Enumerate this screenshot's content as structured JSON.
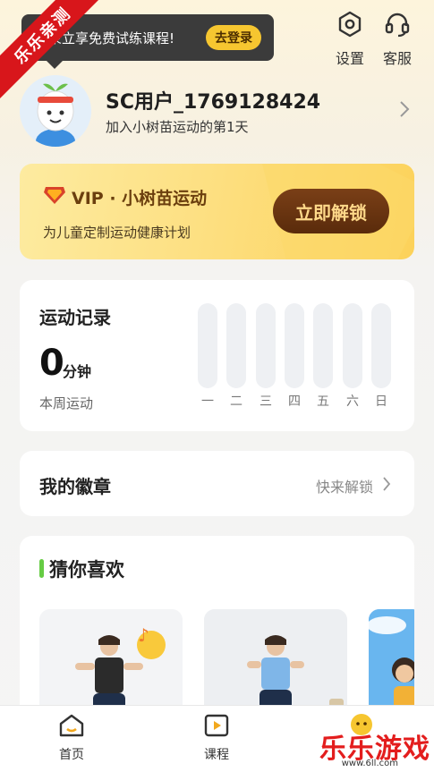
{
  "login_tip": {
    "text": "录立享免费试练课程!",
    "button": "去登录"
  },
  "corner_ribbon": "乐乐亲测",
  "top_icons": {
    "settings": "设置",
    "service": "客服"
  },
  "user": {
    "name": "SC用户_1769128424",
    "subtitle": "加入小树苗运动的第1天"
  },
  "vip": {
    "title": "VIP · 小树苗运动",
    "subtitle": "为儿童定制运动健康计划",
    "button": "立即解锁"
  },
  "record": {
    "title": "运动记录",
    "value": "0",
    "unit": "分钟",
    "subtitle": "本周运动",
    "days": [
      "一",
      "二",
      "三",
      "四",
      "五",
      "六",
      "日"
    ]
  },
  "badges": {
    "title": "我的徽章",
    "action": "快来解锁"
  },
  "guess": {
    "title": "猜你喜欢"
  },
  "tabs": [
    {
      "label": "首页"
    },
    {
      "label": "课程"
    },
    {
      "label": ""
    }
  ],
  "watermark": {
    "text": "乐乐游戏",
    "url": "www.6ll.com"
  },
  "colors": {
    "accent_yellow": "#fcd25a",
    "vip_button": "#5a2b0b",
    "green_mark": "#66cc44"
  }
}
